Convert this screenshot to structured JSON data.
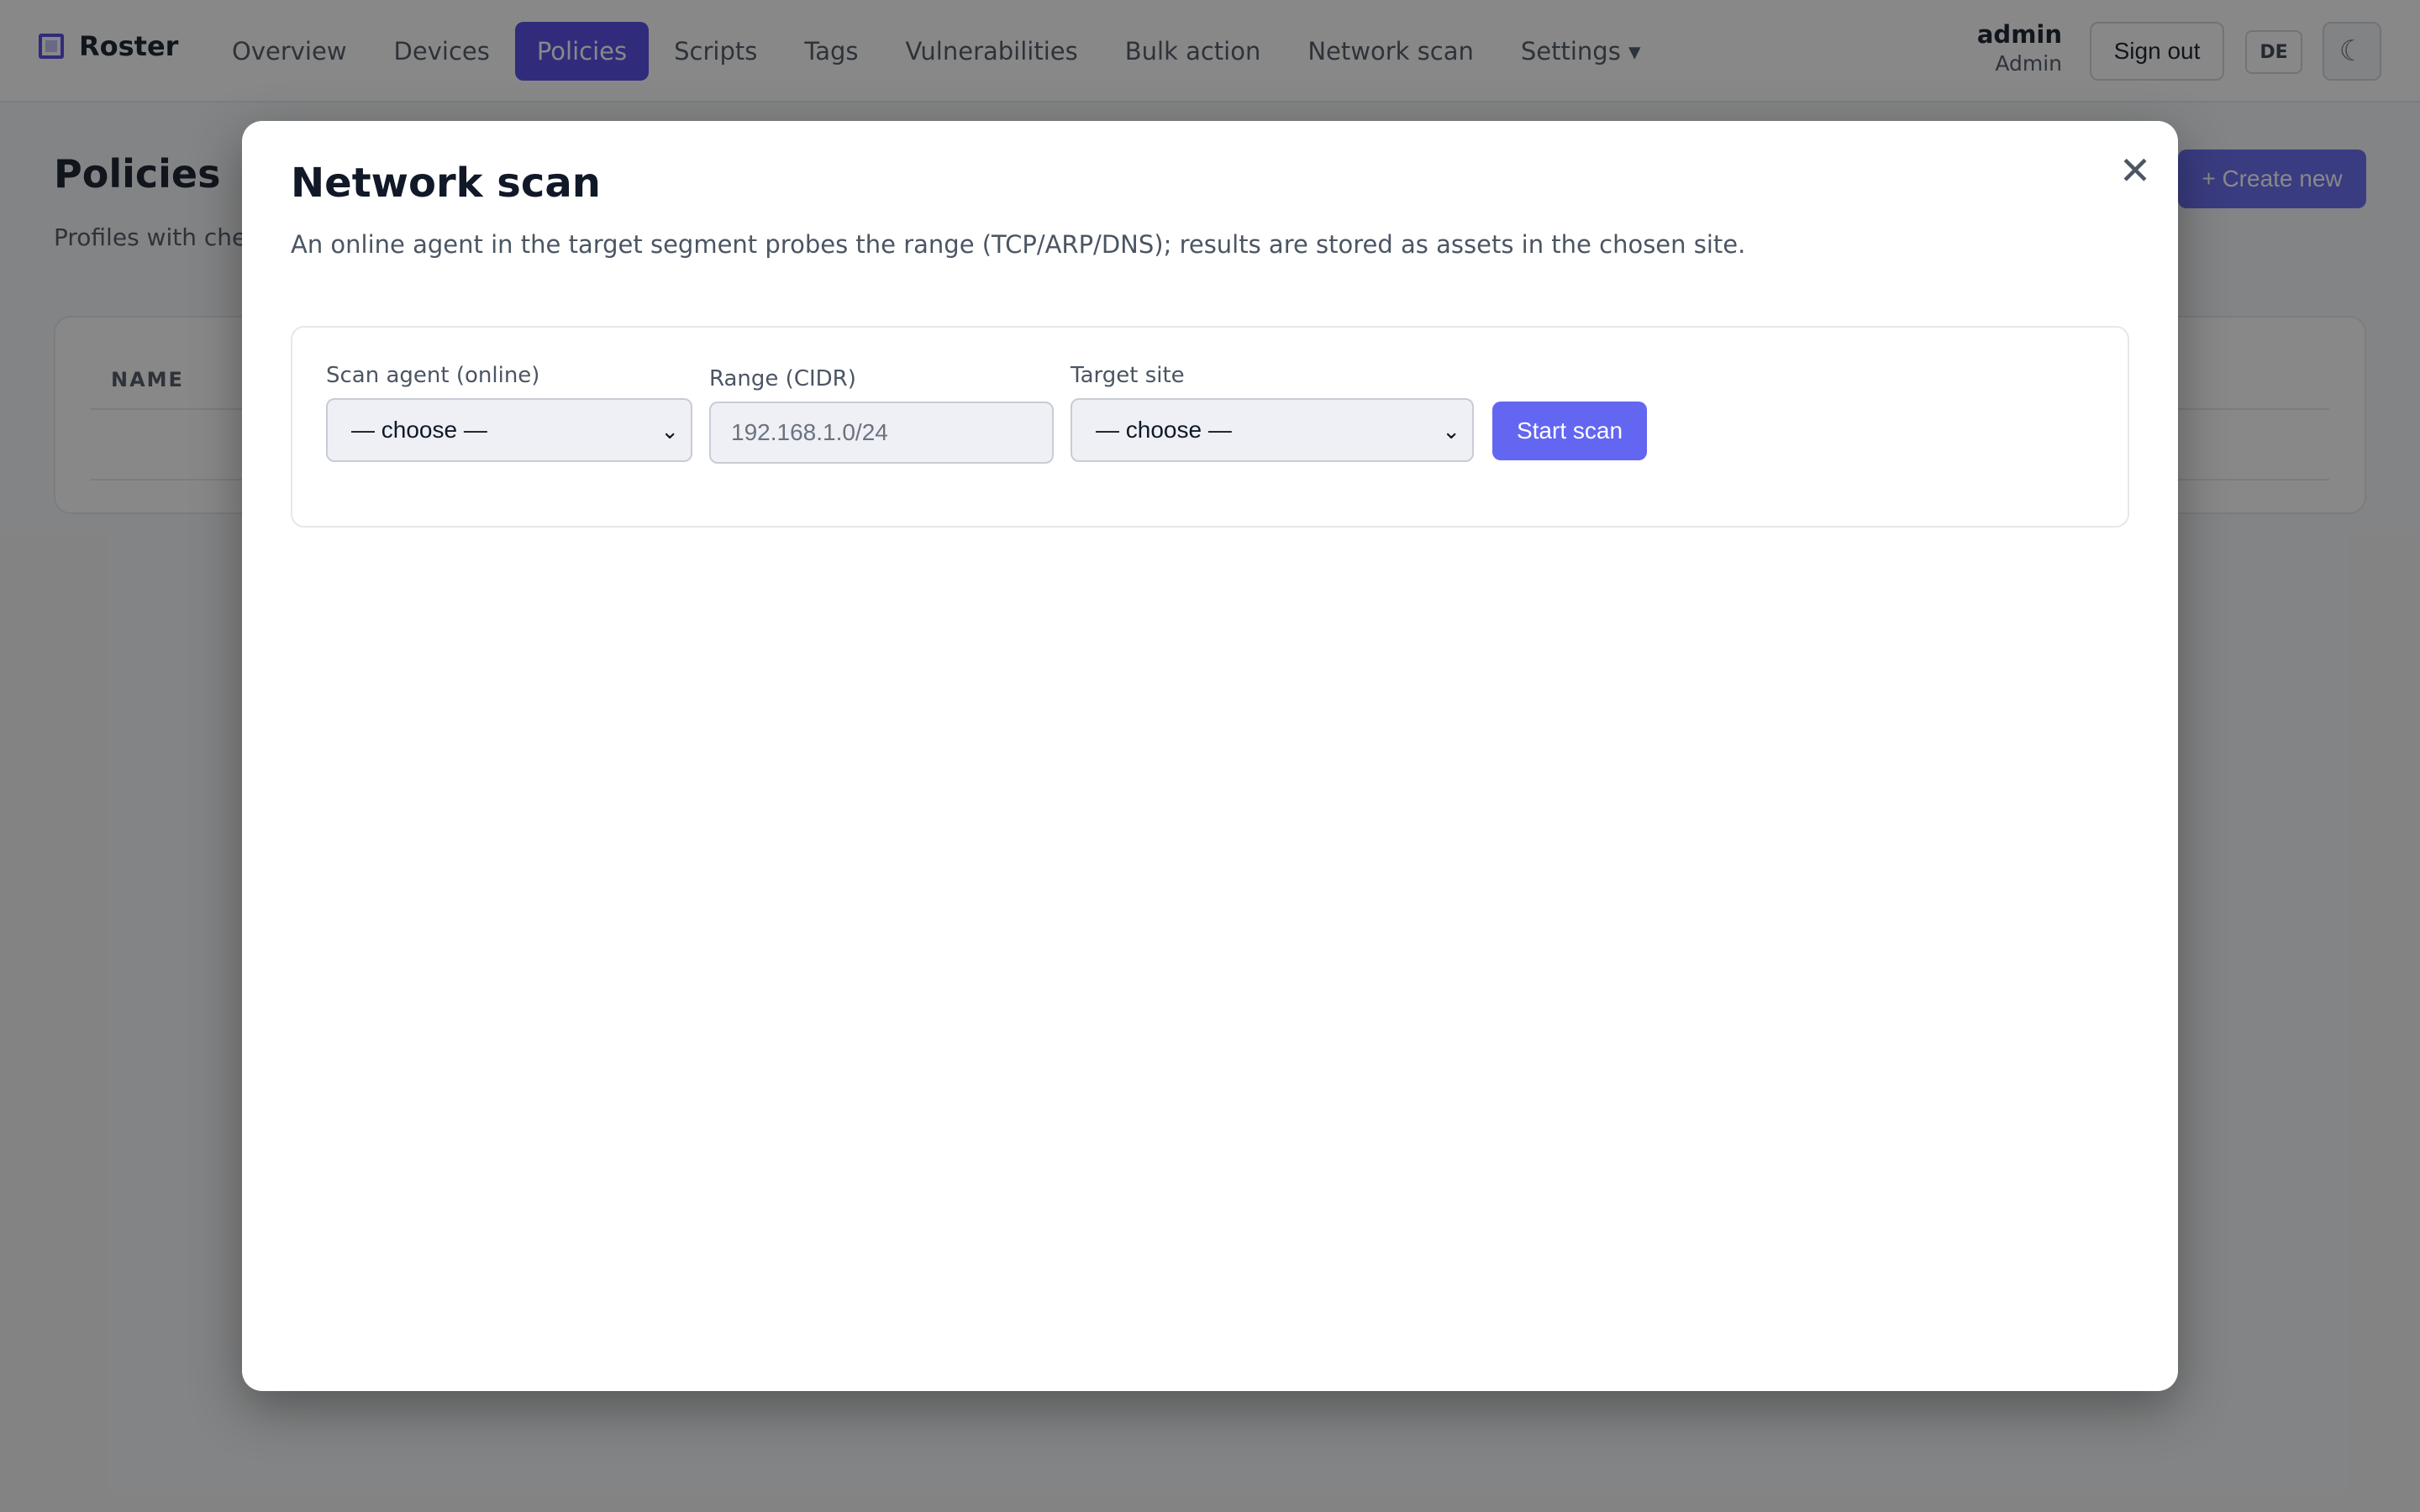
{
  "app": {
    "name": "Roster"
  },
  "nav": {
    "items": [
      {
        "label": "Overview",
        "active": false
      },
      {
        "label": "Devices",
        "active": false
      },
      {
        "label": "Policies",
        "active": true
      },
      {
        "label": "Scripts",
        "active": false
      },
      {
        "label": "Tags",
        "active": false
      },
      {
        "label": "Vulnerabilities",
        "active": false
      },
      {
        "label": "Bulk action",
        "active": false
      },
      {
        "label": "Network scan",
        "active": false
      },
      {
        "label": "Settings ▾",
        "active": false
      }
    ]
  },
  "user": {
    "name": "admin",
    "role": "Admin"
  },
  "header_actions": {
    "sign_out": "Sign out",
    "language": "DE",
    "theme_icon": "☾"
  },
  "page": {
    "title": "Policies",
    "subtitle": "Profiles with chec",
    "create_button": "+ Create new",
    "table": {
      "columns": [
        "NAME"
      ]
    }
  },
  "modal": {
    "title": "Network scan",
    "close_icon": "✕",
    "description": "An online agent in the target segment probes the range (TCP/ARP/DNS); results are stored as assets in the chosen site.",
    "form": {
      "agent_label": "Scan agent (online)",
      "agent_value": "— choose —",
      "range_label": "Range (CIDR)",
      "range_placeholder": "192.168.1.0/24",
      "site_label": "Target site",
      "site_value": "— choose —",
      "submit": "Start scan"
    }
  },
  "colors": {
    "accent": "#4f46e5",
    "button": "#6366f1",
    "overlay": "rgba(17,17,17,0.5)"
  }
}
